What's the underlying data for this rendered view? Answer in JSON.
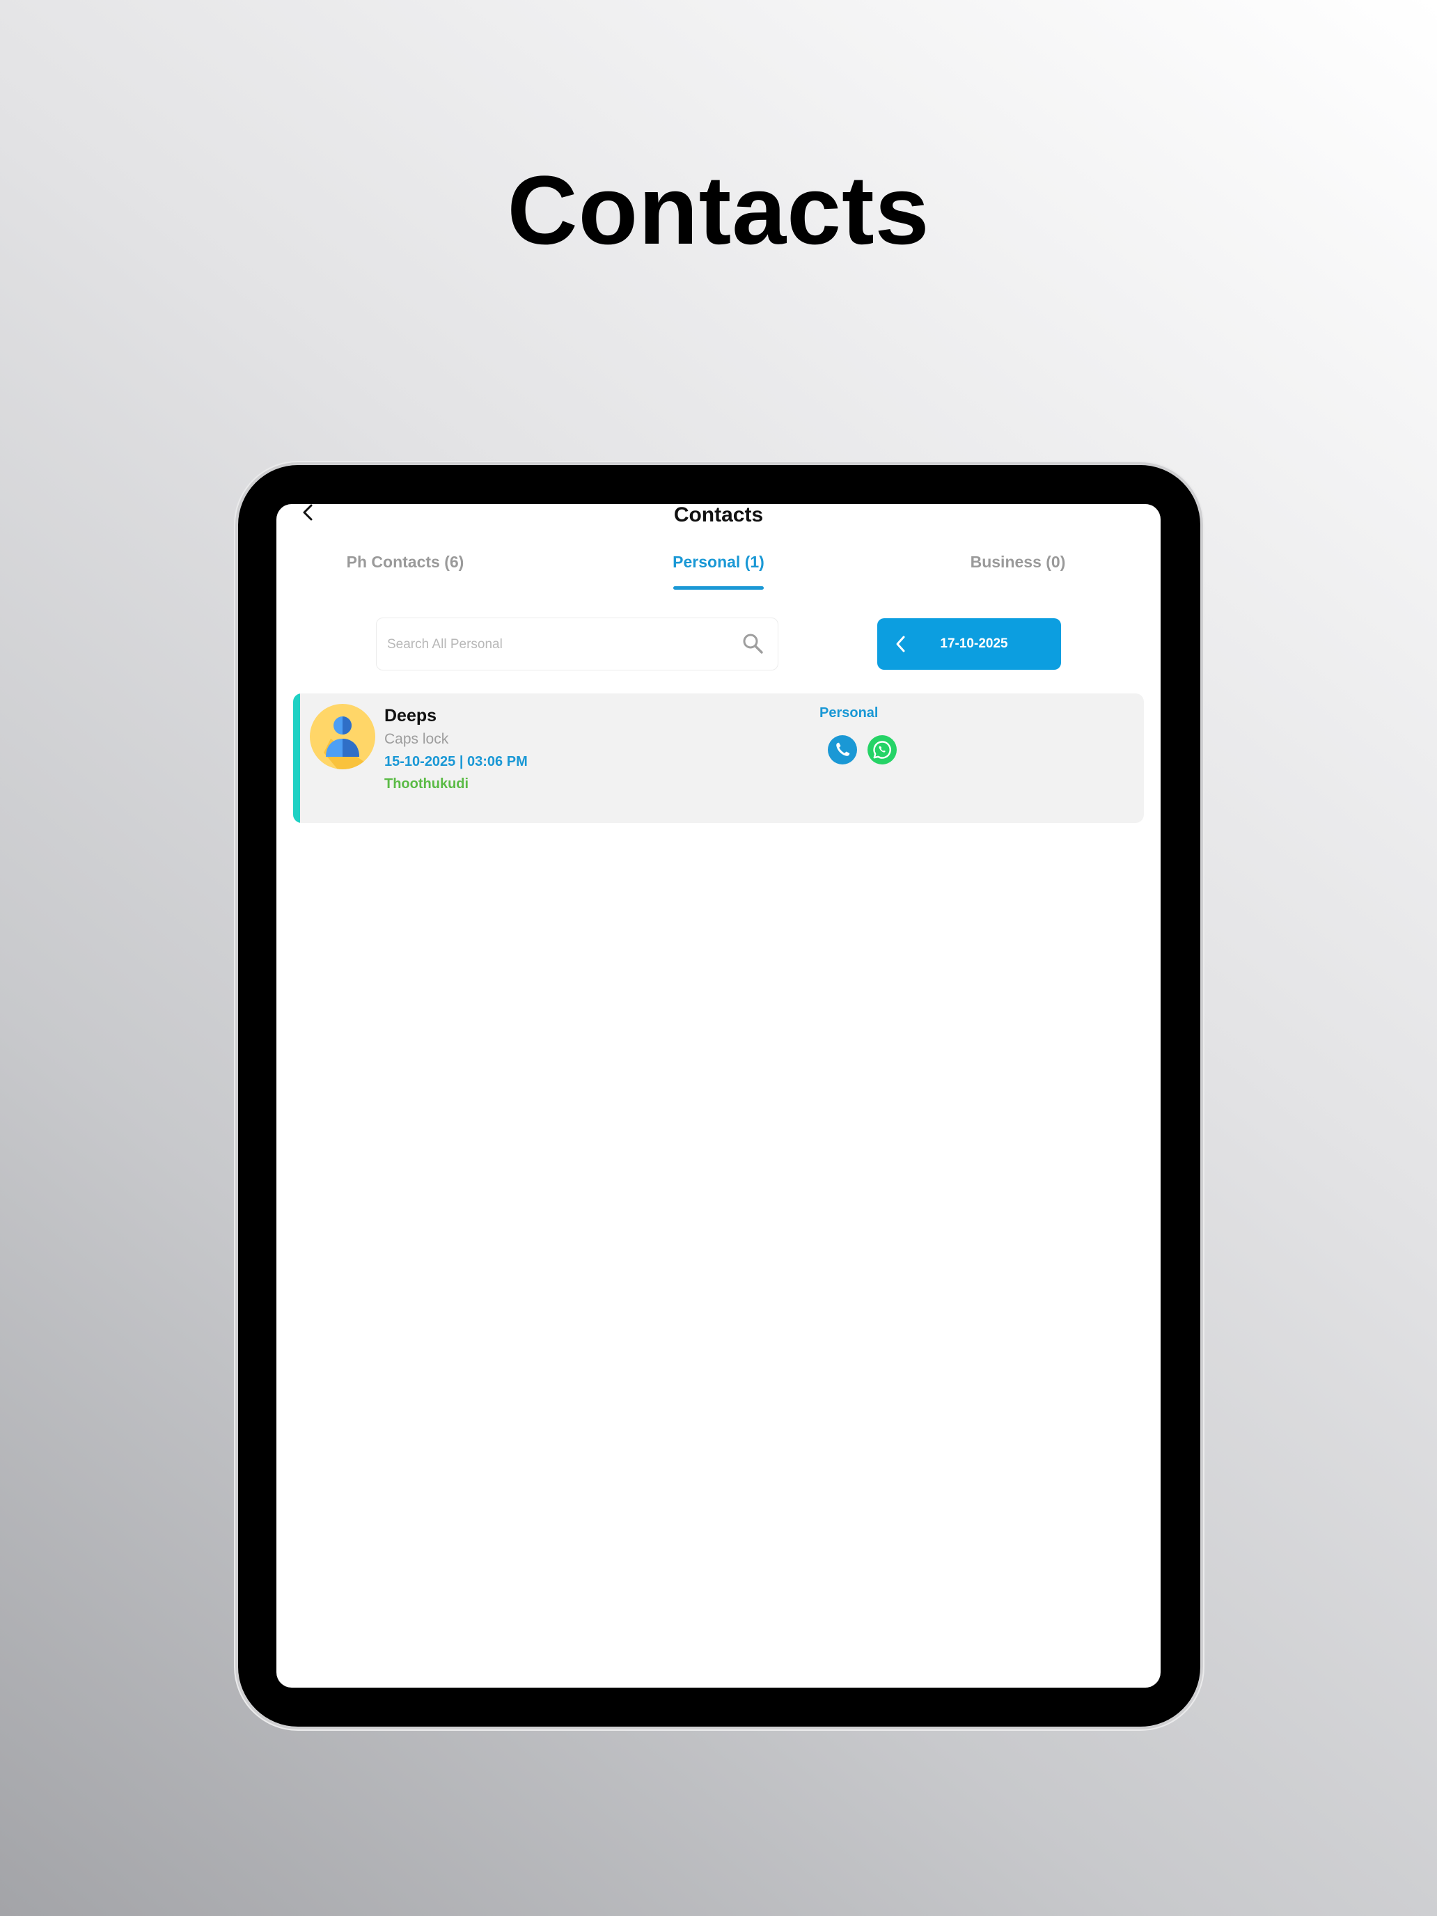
{
  "promo": {
    "title": "Contacts"
  },
  "header": {
    "title": "Contacts",
    "back_icon": "chevron-left-icon"
  },
  "tabs": [
    {
      "label": "Ph Contacts (6)",
      "active": false
    },
    {
      "label": "Personal (1)",
      "active": true
    },
    {
      "label": "Business (0)",
      "active": false
    }
  ],
  "search": {
    "placeholder": "Search All Personal",
    "value": "",
    "icon": "search-icon"
  },
  "date_picker": {
    "value": "17-10-2025",
    "icon": "chevron-left-icon"
  },
  "contacts": [
    {
      "name": "Deeps",
      "subtitle": "Caps lock",
      "datetime": "15-10-2025 | 03:06 PM",
      "location": "Thoothukudi",
      "type": "Personal",
      "actions": [
        "phone-icon",
        "whatsapp-icon"
      ]
    }
  ],
  "colors": {
    "accent": "#1a98d5",
    "date_button": "#0c9ee0",
    "card_stripe": "#1fd1c4",
    "location": "#5bbb46",
    "whatsapp": "#25d366"
  }
}
